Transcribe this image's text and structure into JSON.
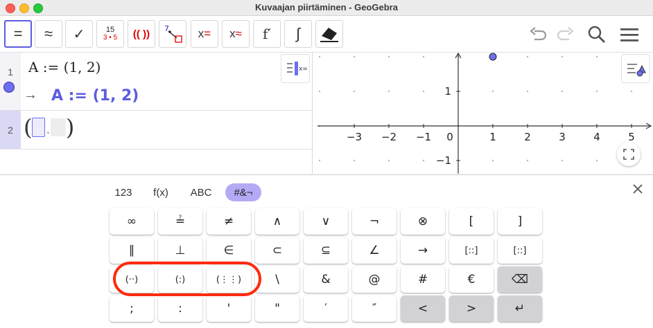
{
  "window": {
    "title": "Kuvaajan piirtäminen - GeoGebra"
  },
  "toolbar": {
    "tools": [
      {
        "name": "evaluate",
        "label": "="
      },
      {
        "name": "numeric",
        "label": "≈"
      },
      {
        "name": "check",
        "label": "✓"
      },
      {
        "name": "factor-numbers",
        "label_top": "15",
        "label_bottom": "3 • 5"
      },
      {
        "name": "expand-brackets",
        "label": "(( ))"
      },
      {
        "name": "substitute",
        "label": "7"
      },
      {
        "name": "solve",
        "label": "x="
      },
      {
        "name": "solve-numeric",
        "label": "x≈"
      },
      {
        "name": "derivative",
        "label": "f′"
      },
      {
        "name": "integral",
        "label": "∫"
      },
      {
        "name": "delete",
        "label": ""
      }
    ]
  },
  "algebra": {
    "rows": [
      {
        "num": "1",
        "input": "A := (1, 2)",
        "output": "A := (1, 2)",
        "arrow": "→"
      },
      {
        "num": "2",
        "input": "(▯,▯)"
      }
    ]
  },
  "graphics": {
    "x_ticks": [
      "−3",
      "−2",
      "−1",
      "0",
      "1",
      "2",
      "3",
      "4",
      "5"
    ],
    "y_ticks": [
      "1",
      "−1"
    ],
    "point": {
      "name": "A",
      "x": 1,
      "y": 2,
      "color": "#6e6ef2"
    }
  },
  "keyboard": {
    "tabs": [
      "123",
      "f(x)",
      "ABC",
      "#&¬"
    ],
    "active_tab": "#&¬",
    "rows": [
      [
        "∞",
        "≟",
        "≠",
        "∧",
        "∨",
        "¬",
        "⊗",
        "[",
        "]"
      ],
      [
        "∥",
        "⊥",
        "∈",
        "⊂",
        "⊆",
        "∠",
        "→",
        "[::]",
        "[::]"
      ],
      [
        "(··)",
        "(:)",
        "(⋮⋮)",
        "\\",
        "&",
        "@",
        "#",
        "€",
        "⌫"
      ],
      [
        ";",
        ":",
        "'",
        "\"",
        "′",
        "″",
        "<",
        ">",
        "↵"
      ]
    ]
  },
  "colors": {
    "accent": "#5c5ce0",
    "highlight": "#ff2a0c",
    "tab_active": "#b3aaf6"
  }
}
